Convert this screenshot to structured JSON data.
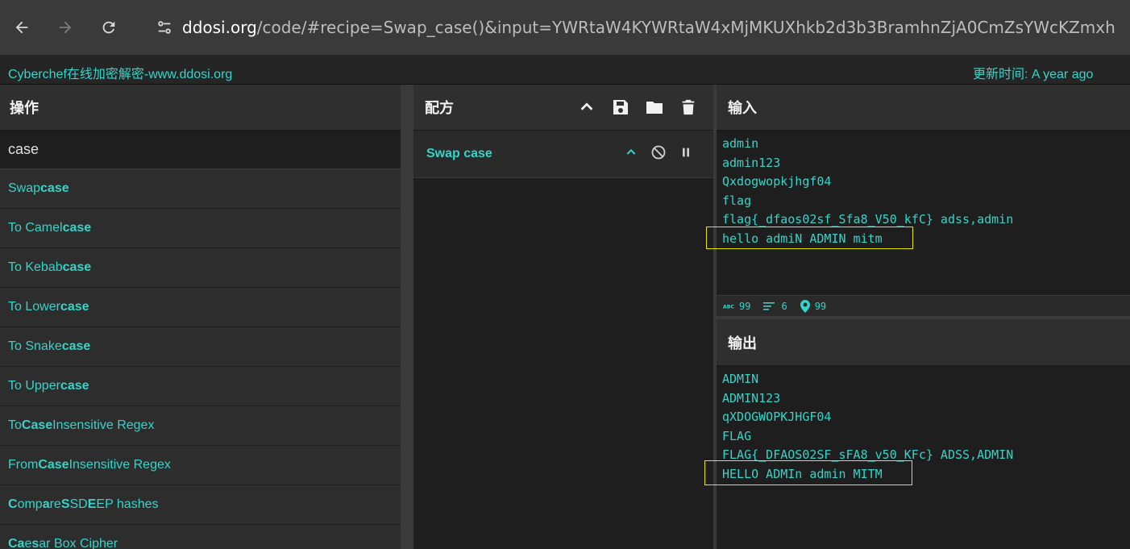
{
  "browser": {
    "url_host": "ddosi.org",
    "url_rest": "/code/#recipe=Swap_case()&input=YWRtaW4KYWRtaW4xMjMKUXhkb2d3b3BramhnZjA0CmZsYWcKZmxh"
  },
  "site": {
    "title": "Cyberchef在线加密解密-www.ddosi.org",
    "updated": "更新时间: A year ago"
  },
  "operations": {
    "header": "操作",
    "search_value": "case",
    "items": [
      {
        "pre": "Swap ",
        "bold": "case",
        "post": ""
      },
      {
        "pre": "To Camel ",
        "bold": "case",
        "post": ""
      },
      {
        "pre": "To Kebab ",
        "bold": "case",
        "post": ""
      },
      {
        "pre": "To Lower ",
        "bold": "case",
        "post": ""
      },
      {
        "pre": "To Snake ",
        "bold": "case",
        "post": ""
      },
      {
        "pre": "To Upper ",
        "bold": "case",
        "post": ""
      },
      {
        "pre": "To ",
        "bold": "Case",
        "post": " Insensitive Regex"
      },
      {
        "pre": "From ",
        "bold": "Case",
        "post": " Insensitive Regex"
      },
      {
        "html": "<b>C</b>omp<b>a</b>re <b>S</b>SD<b>E</b>EP hashes"
      },
      {
        "html": "<b>Ca</b>e<b>s</b>ar Box Cipher"
      }
    ]
  },
  "recipe": {
    "header": "配方",
    "op_name": "Swap case"
  },
  "input": {
    "header": "输入",
    "text": "admin\nadmin123\nQxdogwopkjhgf04\nflag\nflag{_dfaos02sf_Sfa8_V50_kfC} adss,admin\nhello admiN ADMIN mitm",
    "stat_chars": "99",
    "stat_lines": "6",
    "stat_pos": "99"
  },
  "output": {
    "header": "输出",
    "text": "ADMIN\nADMIN123\nqXDOGWOPKJHGF04\nFLAG\nFLAG{_DFAOS02SF_sFA8_v50_KFc} ADSS,ADMIN\nHELLO ADMIn admin MITM"
  },
  "colors": {
    "accent": "#35d4c8",
    "highlight": "#e6e600"
  }
}
